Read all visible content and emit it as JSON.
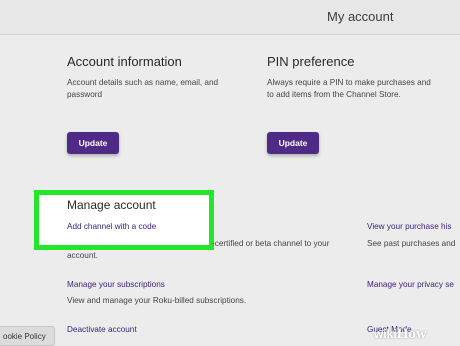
{
  "header": {
    "title": "My account"
  },
  "account_info": {
    "title": "Account information",
    "desc_line1": "Account details such as name, email, and",
    "desc_line2": "password",
    "button": "Update"
  },
  "pin": {
    "title": "PIN preference",
    "desc_line1": "Always require a PIN to make purchases and",
    "desc_line2": "to add items from the Channel Store.",
    "button": "Update"
  },
  "manage": {
    "title": "Manage account",
    "add_channel_link": "Add channel with a code",
    "add_channel_desc_line1": "-certified or beta channel to your",
    "add_channel_desc_line2": "account.",
    "subscriptions_link": "Manage your subscriptions",
    "subscriptions_desc": "View and manage your Roku-billed subscriptions.",
    "deactivate_link": "Deactivate account"
  },
  "right_column": {
    "purchase_link": "View your purchase his",
    "purchase_desc": "See past purchases and",
    "privacy_link": "Manage your privacy se",
    "guest_link": "Guest Mode"
  },
  "cookie_button": "ookie Policy",
  "watermark": {
    "wiki": "wiki",
    "how": "How"
  },
  "colors": {
    "brand_purple": "#4f2a86",
    "link": "#3a1f79",
    "highlight": "#23e52a"
  }
}
